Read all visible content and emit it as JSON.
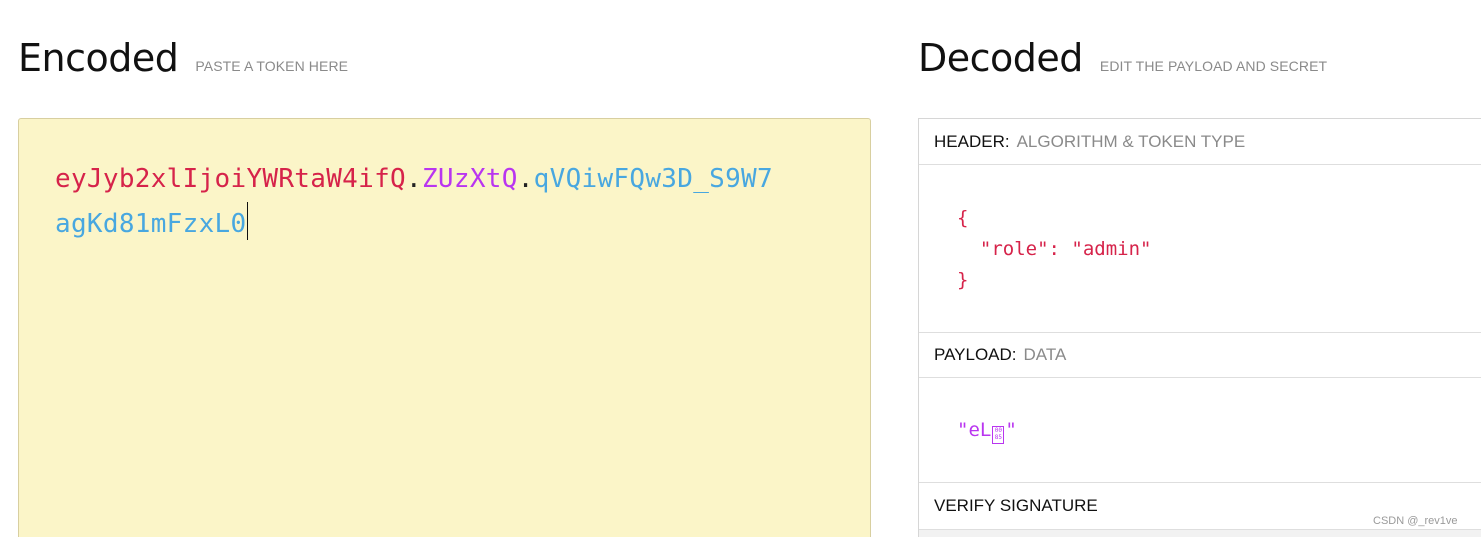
{
  "encoded": {
    "title": "Encoded",
    "subtitle": "PASTE A TOKEN HERE",
    "token": {
      "header": "eyJyb2xlIjoiYWRtaW4ifQ",
      "dot1": ".",
      "payload": "ZUzXtQ",
      "dot2": ".",
      "signature": "qVQiwFQw3D_S9W7agKd81mFzxL0"
    }
  },
  "decoded": {
    "title": "Decoded",
    "subtitle": "EDIT THE PAYLOAD AND SECRET",
    "header_section": {
      "label": "HEADER:",
      "desc": "ALGORITHM & TOKEN TYPE",
      "json_lines": [
        "{",
        "  \"role\": \"admin\"",
        "}"
      ]
    },
    "payload_section": {
      "label": "PAYLOAD:",
      "desc": "DATA",
      "value_prefix": "\"eL",
      "value_suffix": "\""
    },
    "verify_section": {
      "label": "VERIFY SIGNATURE"
    }
  },
  "watermark": "CSDN @_rev1ve",
  "colors": {
    "header": "#d6234a",
    "payload": "#b935f0",
    "signature": "#48a7e0",
    "encoded_bg": "#fbf5c8"
  }
}
